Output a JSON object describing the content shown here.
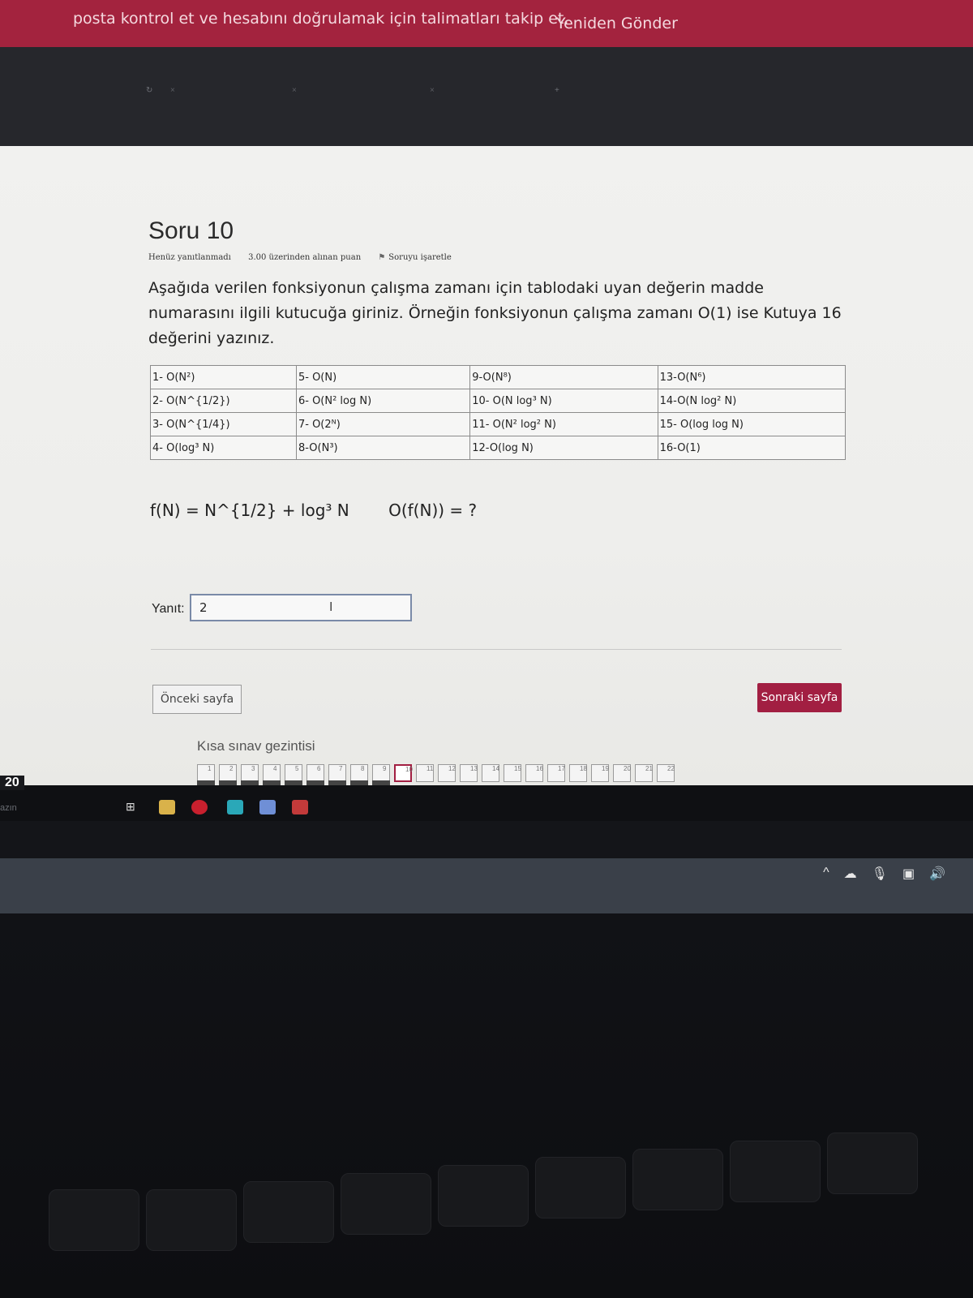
{
  "banner": {
    "message": "posta kontrol et ve hesabını doğrulamak için talimatları takip et.",
    "resend_label": "Yeniden Gönder"
  },
  "question": {
    "title": "Soru 10",
    "status": "Henüz yanıtlanmadı",
    "points": "3.00 üzerinden alınan puan",
    "flag_label": "Soruyu işaretle",
    "text": "Aşağıda verilen fonksiyonun çalışma zamanı için tablodaki uyan değerin madde numarasını ilgili kutucuğa giriniz. Örneğin fonksiyonun çalışma zamanı O(1) ise Kutuya 16 değerini yazınız.",
    "table": [
      [
        "1- O(N²)",
        "5- O(N)",
        "9-O(N⁸)",
        "13-O(N⁶)"
      ],
      [
        "2- O(N^{1/2})",
        "6- O(N² log N)",
        "10- O(N log³ N)",
        "14-O(N log² N)"
      ],
      [
        "3- O(N^{1/4})",
        "7- O(2ᴺ)",
        "11- O(N² log² N)",
        "15- O(log log N)"
      ],
      [
        "4- O(log³ N)",
        "8-O(N³)",
        "12-O(log N)",
        "16-O(1)"
      ]
    ],
    "formula": "f(N) = N^{1/2} + log³ N",
    "question_expr": "O(f(N)) = ?"
  },
  "answer": {
    "label": "Yanıt:",
    "value": "2"
  },
  "navigation": {
    "prev_label": "Önceki sayfa",
    "next_label": "Sonraki sayfa",
    "quiz_nav_title": "Kısa sınav gezintisi",
    "pages": [
      "1",
      "2",
      "3",
      "4",
      "5",
      "6",
      "7",
      "8",
      "9",
      "10",
      "11",
      "12",
      "13",
      "14",
      "15",
      "16",
      "17",
      "18",
      "19",
      "20",
      "21",
      "22"
    ],
    "answered_count": 9,
    "current_page": "10"
  },
  "taskbar": {
    "side_number": "20",
    "side_label": "azın"
  },
  "colors": {
    "banner": "#a3233e",
    "accent": "#a21f42",
    "page_bg": "#f1f1ef"
  }
}
